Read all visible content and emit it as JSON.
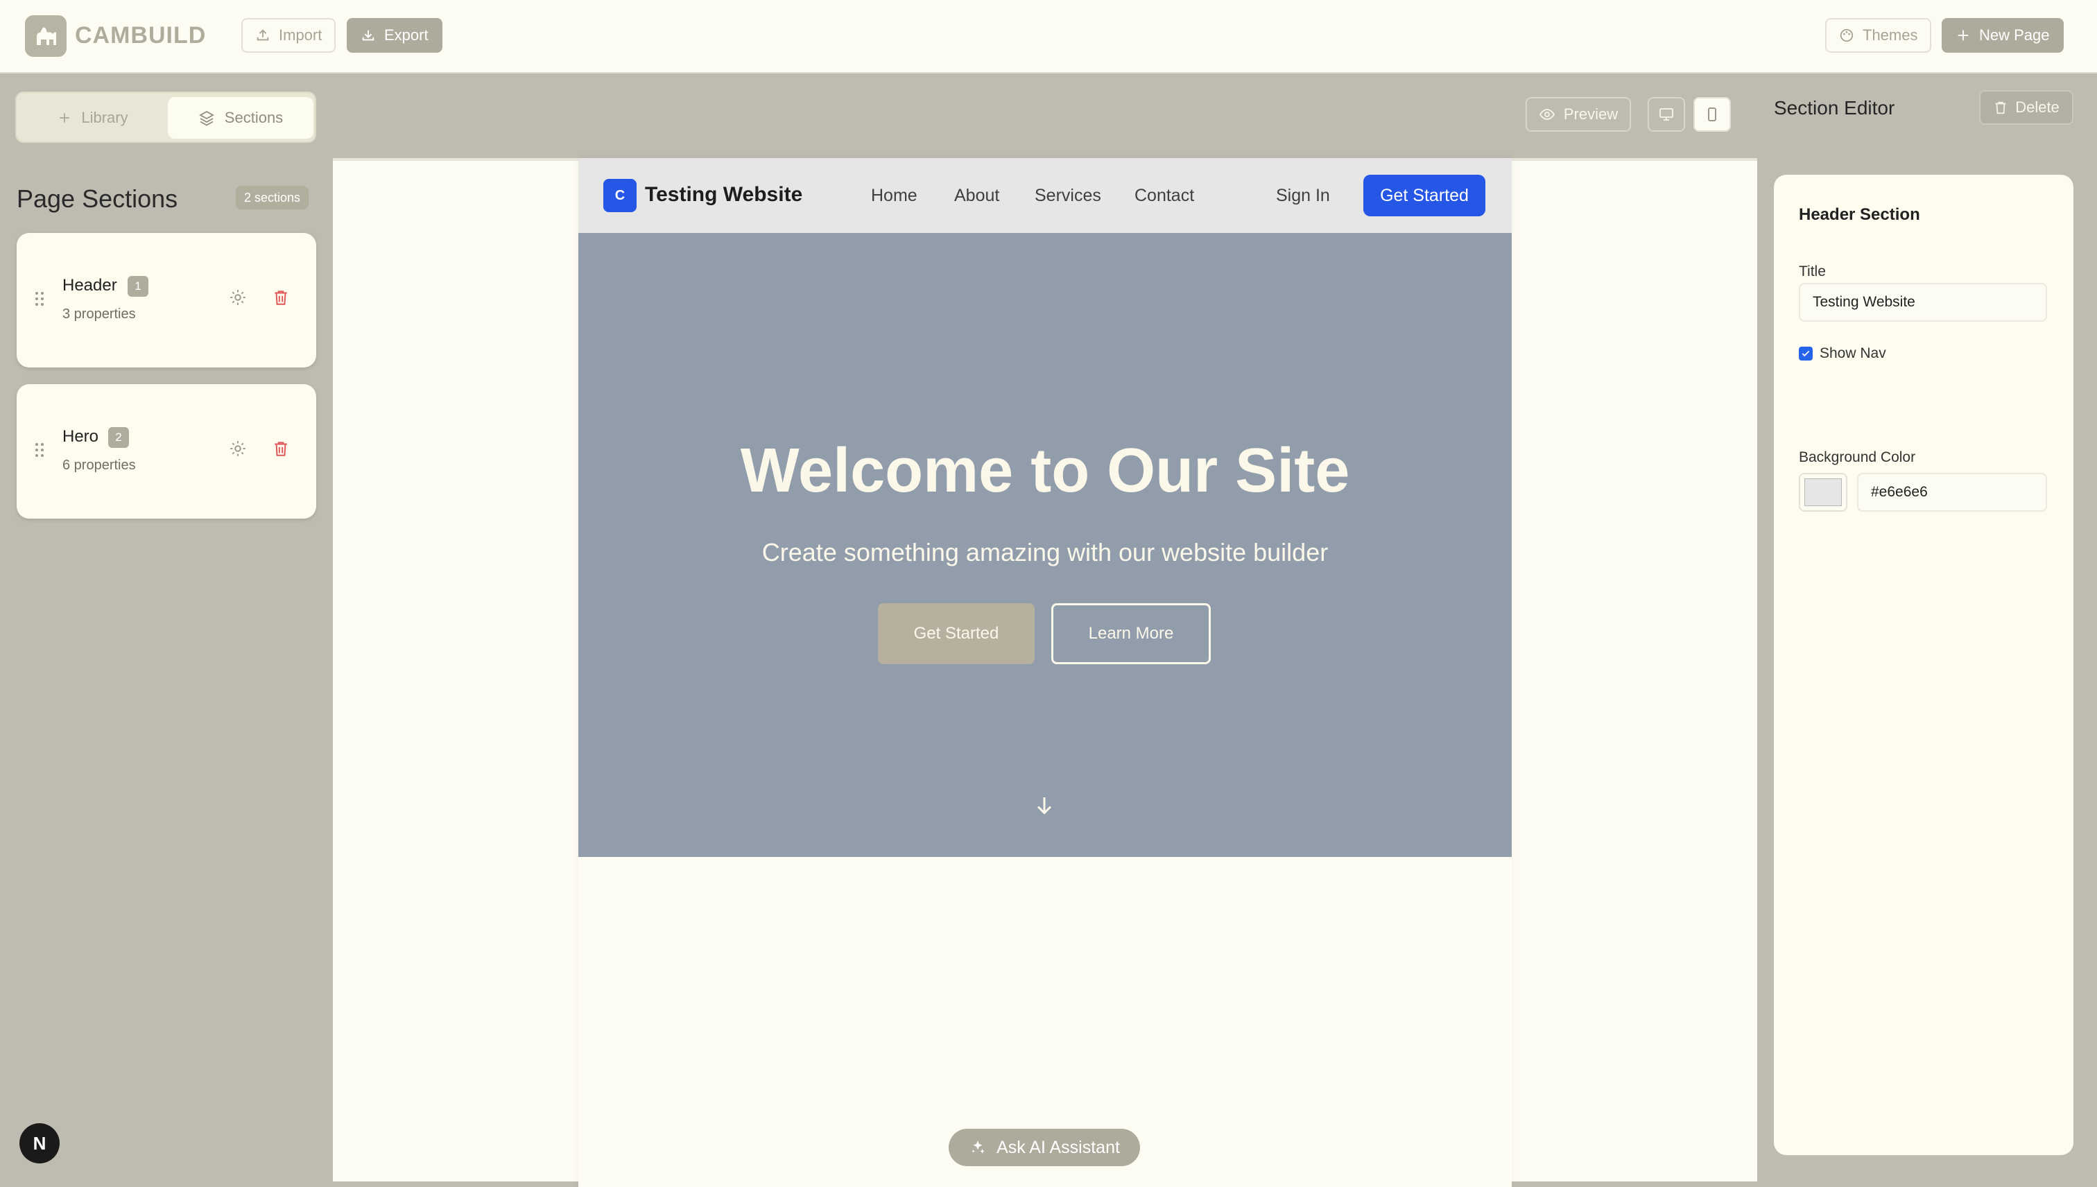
{
  "app": {
    "name": "CAMBUILD"
  },
  "toolbar": {
    "import_label": "Import",
    "export_label": "Export",
    "themes_label": "Themes",
    "new_page_label": "New Page"
  },
  "sidebar": {
    "tabs": [
      {
        "label": "Library",
        "icon": "plus-icon"
      },
      {
        "label": "Sections",
        "icon": "layers-icon",
        "active": true
      }
    ],
    "title": "Page Sections",
    "count_label": "2 sections",
    "sections": [
      {
        "name": "Header",
        "index": "1",
        "props": "3 properties"
      },
      {
        "name": "Hero",
        "index": "2",
        "props": "6 properties"
      }
    ]
  },
  "canvas": {
    "preview_label": "Preview",
    "device_modes": [
      "desktop",
      "mobile"
    ],
    "active_device": "mobile",
    "ai_label": "Ask AI Assistant"
  },
  "site": {
    "logo_letter": "C",
    "title": "Testing Website",
    "nav": [
      "Home",
      "About",
      "Services",
      "Contact"
    ],
    "signin": "Sign In",
    "cta": "Get Started",
    "header_bg": "#e6e6e6",
    "accent": "#2556e6"
  },
  "hero": {
    "heading": "Welcome to Our Site",
    "subheading": "Create something amazing with our website builder",
    "primary_btn": "Get Started",
    "secondary_btn": "Learn More",
    "bg": "#929dab"
  },
  "editor": {
    "title": "Section Editor",
    "delete_label": "Delete",
    "section_title": "Header Section",
    "fields": {
      "title_label": "Title",
      "title_value": "Testing Website",
      "show_nav_label": "Show Nav",
      "show_nav_checked": true,
      "bg_label": "Background Color",
      "bg_value": "#e6e6e6"
    }
  },
  "framework_badge": "N"
}
